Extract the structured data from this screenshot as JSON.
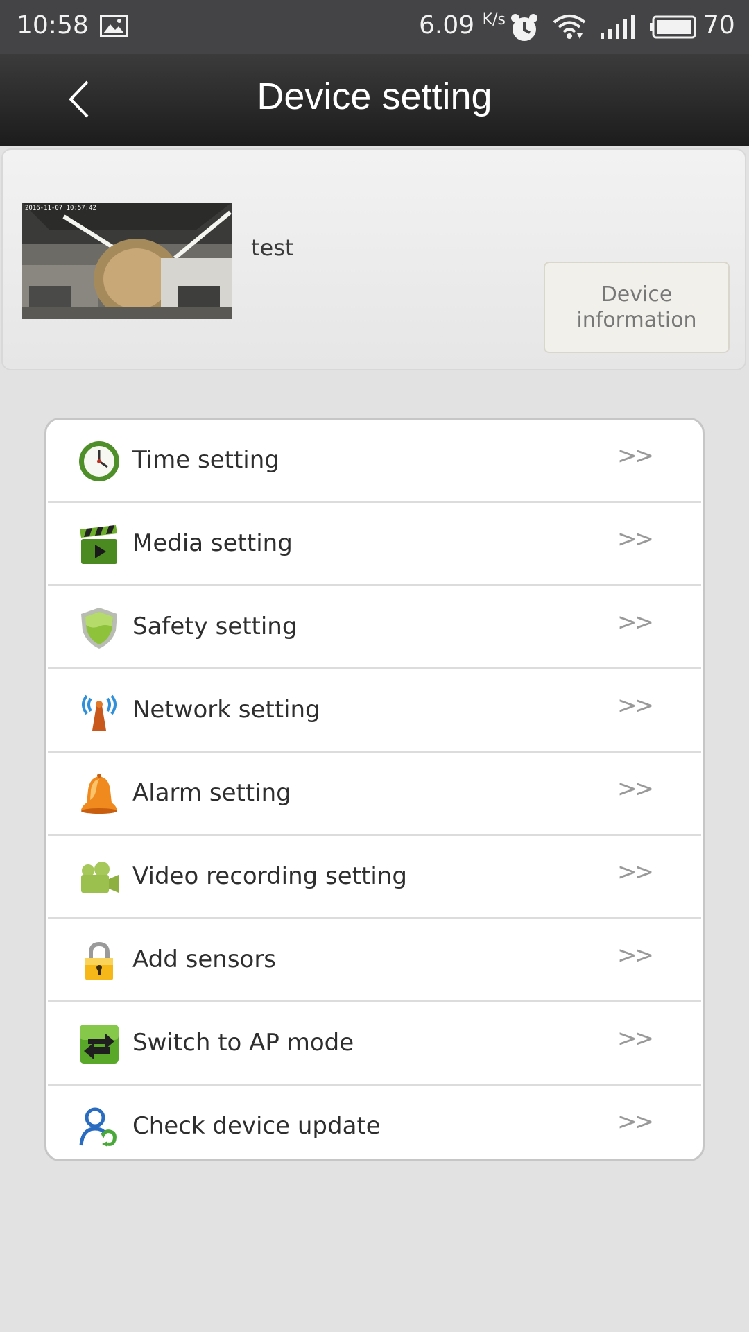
{
  "status_bar": {
    "time": "10:58",
    "speed": "6.09",
    "speed_unit": "K/s",
    "battery": "70"
  },
  "header": {
    "title": "Device setting"
  },
  "device": {
    "name": "test",
    "thumbnail_timestamp": "2016-11-07  10:57:42",
    "info_button": "Device\ninformation"
  },
  "menu": {
    "chevron": ">>",
    "items": [
      {
        "label": "Time setting",
        "icon": "clock-icon"
      },
      {
        "label": "Media setting",
        "icon": "clapperboard-icon"
      },
      {
        "label": "Safety setting",
        "icon": "shield-icon"
      },
      {
        "label": "Network setting",
        "icon": "antenna-icon"
      },
      {
        "label": "Alarm setting",
        "icon": "bell-icon"
      },
      {
        "label": "Video recording setting",
        "icon": "video-camera-icon"
      },
      {
        "label": "Add sensors",
        "icon": "lock-icon"
      },
      {
        "label": "Switch to AP mode",
        "icon": "switch-arrows-icon"
      },
      {
        "label": "Check device update",
        "icon": "user-update-icon"
      }
    ]
  }
}
